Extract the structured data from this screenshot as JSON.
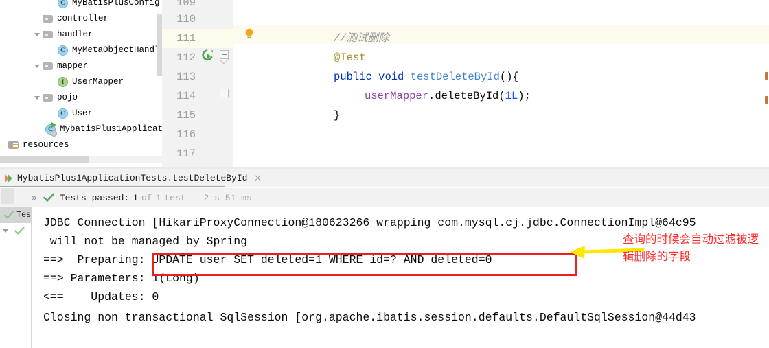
{
  "project_tree": {
    "items": [
      {
        "label": "MyBatisPlusConfig",
        "icon": "class-icon",
        "kind": "class",
        "indent": 3,
        "arrow": "none",
        "clipped_top": true
      },
      {
        "label": "controller",
        "icon": "folder-icon",
        "kind": "folder",
        "indent": 2,
        "arrow": "none"
      },
      {
        "label": "handler",
        "icon": "folder-icon",
        "kind": "folder",
        "indent": 2,
        "arrow": "open"
      },
      {
        "label": "MyMetaObjectHandl",
        "icon": "class-icon",
        "kind": "class",
        "indent": 3,
        "arrow": "none"
      },
      {
        "label": "mapper",
        "icon": "folder-icon",
        "kind": "folder",
        "indent": 2,
        "arrow": "open"
      },
      {
        "label": "UserMapper",
        "icon": "interface-icon",
        "kind": "interface",
        "indent": 3,
        "arrow": "none"
      },
      {
        "label": "pojo",
        "icon": "folder-icon",
        "kind": "folder",
        "indent": 2,
        "arrow": "open"
      },
      {
        "label": "User",
        "icon": "class-icon",
        "kind": "class",
        "indent": 3,
        "arrow": "none"
      },
      {
        "label": "MybatisPlus1Applicat",
        "icon": "spring-boot-class-icon",
        "kind": "spring",
        "indent": 3,
        "arrow": "none"
      },
      {
        "label": "resources",
        "icon": "resources-folder-icon",
        "kind": "resources",
        "indent": 0,
        "arrow": "none"
      }
    ]
  },
  "editor": {
    "gutter_lines": [
      "109",
      "110",
      "111",
      "112",
      "113",
      "114",
      "115",
      "116",
      "117"
    ],
    "highlighted_line": "111",
    "run_marker_line": "112",
    "lines": [
      {
        "num": "110",
        "indent": 1,
        "tokens": [
          {
            "t": "//测试删除",
            "c": "comment"
          }
        ]
      },
      {
        "num": "111",
        "indent": 1,
        "tokens": [
          {
            "t": "@Test",
            "c": "anno"
          }
        ]
      },
      {
        "num": "112",
        "indent": 1,
        "tokens": [
          {
            "t": "public",
            "c": "kw"
          },
          {
            "t": " ",
            "c": "plain"
          },
          {
            "t": "void",
            "c": "kw"
          },
          {
            "t": " ",
            "c": "plain"
          },
          {
            "t": "testDeleteById",
            "c": "method"
          },
          {
            "t": "(){",
            "c": "plain"
          }
        ]
      },
      {
        "num": "113",
        "indent": 2,
        "tokens": [
          {
            "t": "userMapper",
            "c": "field"
          },
          {
            "t": ".deleteById(",
            "c": "plain"
          },
          {
            "t": "1L",
            "c": "num"
          },
          {
            "t": ");",
            "c": "plain"
          }
        ]
      },
      {
        "num": "114",
        "indent": 1,
        "tokens": [
          {
            "t": "}",
            "c": "plain"
          }
        ]
      },
      {
        "num": "117",
        "indent": 0,
        "tokens": [
          {
            "t": "}",
            "c": "plain"
          }
        ]
      }
    ]
  },
  "run_window": {
    "tab_title": "MybatisPlus1ApplicationTests.testDeleteById",
    "status": {
      "tests_passed_label": "Tests passed:",
      "passed_count": "1",
      "of_label": "of",
      "total_count": "1",
      "test_word": "test",
      "dash": "–",
      "duration": "2 s 51 ms"
    },
    "test_tree": {
      "selected_label": "Tes"
    },
    "console_lines": [
      "JDBC Connection [HikariProxyConnection@180623266 wrapping com.mysql.cj.jdbc.ConnectionImpl@64c95",
      " will not be managed by Spring",
      "==>  Preparing: UPDATE user SET deleted=1 WHERE id=? AND deleted=0",
      "==> Parameters: 1(Long)",
      "<==    Updates: 0",
      "Closing non transactional SqlSession [org.apache.ibatis.session.defaults.DefaultSqlSession@44d43"
    ]
  },
  "annotations": {
    "note_text": "查询的时候会自动过滤被逻辑删除的字段",
    "note_color": "#fb2c2c",
    "box_color": "#f01f1f",
    "arrow_color": "#ffe800"
  }
}
